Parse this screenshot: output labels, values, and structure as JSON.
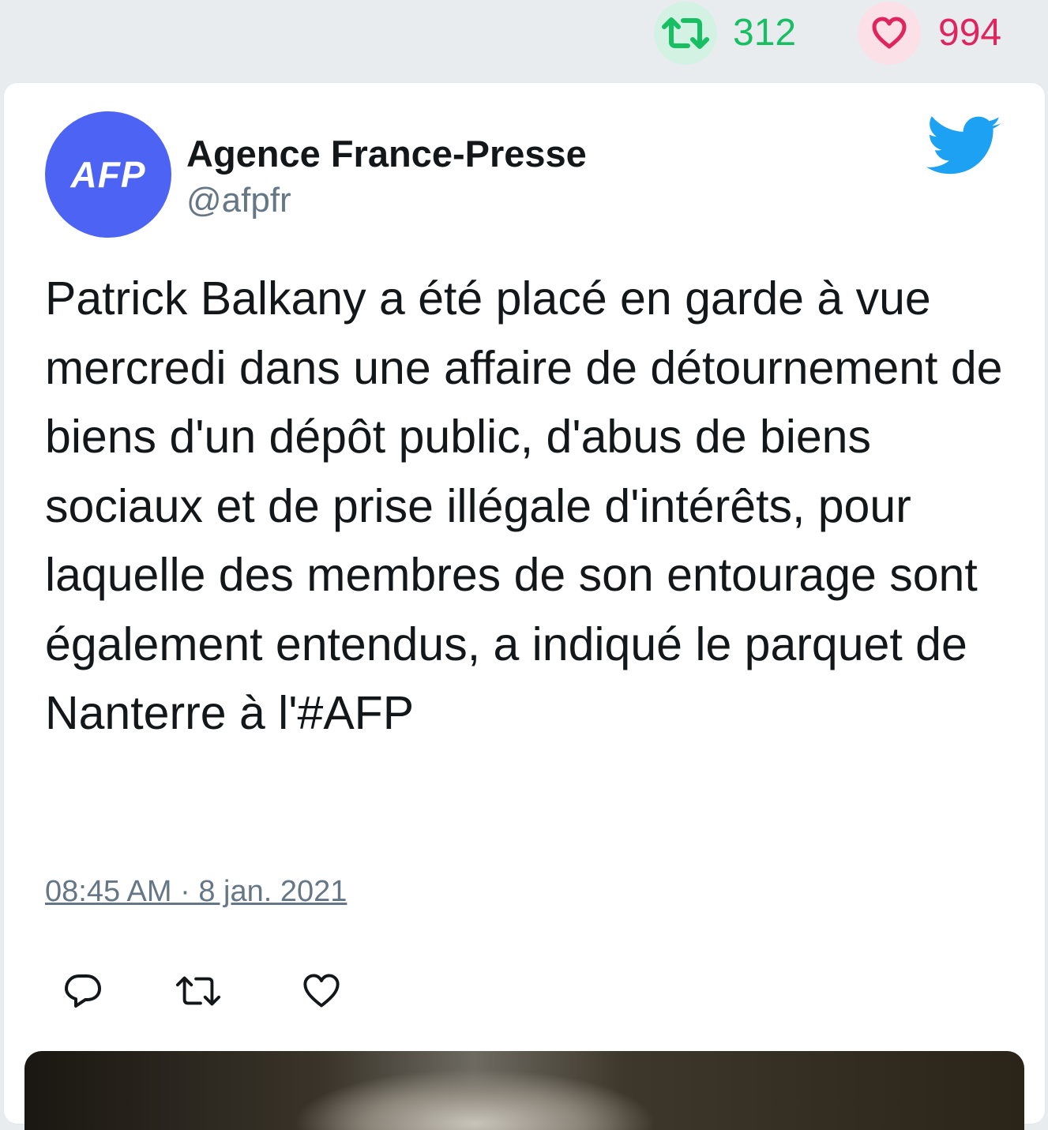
{
  "stats": {
    "retweets": "312",
    "likes": "994",
    "retweet_color": "#17bf63",
    "like_color": "#e0245e"
  },
  "author": {
    "avatar_text": "AFP",
    "name": "Agence France-Presse",
    "handle": "@afpfr",
    "brand_color": "#4c63f4"
  },
  "tweet": {
    "text": "Patrick Balkany a été placé en garde à vue mercredi dans une affaire de détournement de biens d'un dépôt public, d'abus de biens sociaux et de prise illégale d'intérêts, pour laquelle des membres de son entourage sont également entendus, a indiqué le parquet de Nanterre à l'#AFP",
    "timestamp": "08:45 AM · 8 jan. 2021"
  },
  "icons": {
    "platform": "twitter-bird-icon",
    "reply": "reply-icon",
    "retweet": "retweet-icon",
    "like": "heart-icon"
  }
}
